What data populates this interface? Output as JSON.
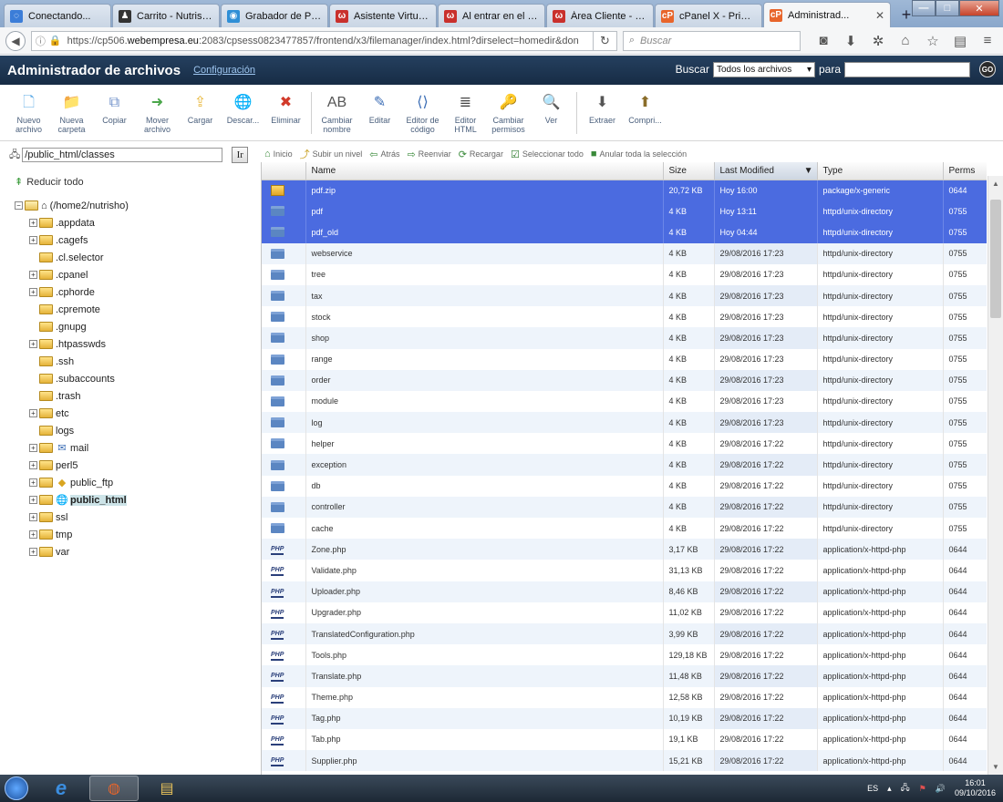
{
  "browser": {
    "tabs": [
      {
        "label": "Conectando...",
        "icon": "loading-icon",
        "color": "#3b7dd8",
        "glyph": "◌"
      },
      {
        "label": "Carrito - Nutrish...",
        "icon": "cart-icon",
        "color": "#333333",
        "glyph": "♟"
      },
      {
        "label": "Grabador de Pa...",
        "icon": "recorder-icon",
        "color": "#2f8fd6",
        "glyph": "◉"
      },
      {
        "label": "Asistente Virtual...",
        "icon": "w-icon",
        "color": "#c9302c",
        "glyph": "ω"
      },
      {
        "label": "Al entrar en el b...",
        "icon": "w-icon",
        "color": "#c9302c",
        "glyph": "ω"
      },
      {
        "label": "Área Cliente - W...",
        "icon": "w-icon",
        "color": "#c9302c",
        "glyph": "ω"
      },
      {
        "label": "cPanel X - Princi...",
        "icon": "cpanel-icon",
        "color": "#e8652b",
        "glyph": "cP"
      },
      {
        "label": "Administrad...",
        "icon": "cpanel-icon",
        "color": "#e8652b",
        "glyph": "cP"
      }
    ],
    "url_prefix": "https://cp506.",
    "url_domain": "webempresa.eu",
    "url_rest": ":2083/cpsess0823477857/frontend/x3/filemanager/index.html?dirselect=homedir&don",
    "search_placeholder": "Buscar"
  },
  "header": {
    "title": "Administrador de archivos",
    "config_link": "Configuración",
    "search_label": "Buscar",
    "search_scope": "Todos los archivos",
    "for_label": "para",
    "go_label": "GO"
  },
  "toolbar": [
    {
      "label": "Nuevo archivo",
      "icon": "new-file-icon",
      "glyph": "🗋",
      "color": "#5aa9e6"
    },
    {
      "label": "Nueva carpeta",
      "icon": "new-folder-icon",
      "glyph": "📁",
      "color": "#e8b83c"
    },
    {
      "label": "Copiar",
      "icon": "copy-icon",
      "glyph": "⧉",
      "color": "#6a8cc7"
    },
    {
      "label": "Mover archivo",
      "icon": "move-file-icon",
      "glyph": "➜",
      "color": "#4aa64a"
    },
    {
      "label": "Cargar",
      "icon": "upload-icon",
      "glyph": "⇪",
      "color": "#e8b83c"
    },
    {
      "label": "Descar...",
      "icon": "download-icon",
      "glyph": "🌐",
      "color": "#3b7dd8"
    },
    {
      "label": "Eliminar",
      "icon": "delete-icon",
      "glyph": "✖",
      "color": "#d23a2a"
    },
    {
      "label": "Cambiar nombre",
      "icon": "rename-icon",
      "glyph": "AB",
      "color": "#555555"
    },
    {
      "label": "Editar",
      "icon": "edit-icon",
      "glyph": "✎",
      "color": "#3b6db5"
    },
    {
      "label": "Editor de código",
      "icon": "code-editor-icon",
      "glyph": "⟨⟩",
      "color": "#3b6db5"
    },
    {
      "label": "Editor HTML",
      "icon": "html-editor-icon",
      "glyph": "≣",
      "color": "#444444"
    },
    {
      "label": "Cambiar permisos",
      "icon": "permissions-icon",
      "glyph": "🔑",
      "color": "#d9a520"
    },
    {
      "label": "Ver",
      "icon": "view-icon",
      "glyph": "🔍",
      "color": "#3b7dd8"
    },
    {
      "label": "Extraer",
      "icon": "extract-icon",
      "glyph": "⬇",
      "color": "#555555"
    },
    {
      "label": "Compri...",
      "icon": "compress-icon",
      "glyph": "⬆",
      "color": "#8a6d2a"
    }
  ],
  "path": {
    "value": "/public_html/classes",
    "go_label": "Ir"
  },
  "subtoolbar": [
    {
      "label": "Inicio",
      "icon": "home-icon",
      "glyph": "⌂"
    },
    {
      "label": "Subir un nivel",
      "icon": "up-level-icon",
      "glyph": "⤴"
    },
    {
      "label": "Atrás",
      "icon": "back-icon",
      "glyph": "⇦"
    },
    {
      "label": "Reenviar",
      "icon": "forward-icon",
      "glyph": "⇨"
    },
    {
      "label": "Recargar",
      "icon": "reload-icon",
      "glyph": "⟳"
    },
    {
      "label": "Seleccionar todo",
      "icon": "select-all-icon",
      "glyph": "☑"
    },
    {
      "label": "Anular toda la selección",
      "icon": "unselect-all-icon",
      "glyph": "■"
    }
  ],
  "tree": {
    "collapse_label": "Reducir todo",
    "root": "(/home2/nutrisho)",
    "items": [
      {
        "label": ".appdata",
        "exp": true
      },
      {
        "label": ".cagefs",
        "exp": true
      },
      {
        "label": ".cl.selector",
        "exp": false
      },
      {
        "label": ".cpanel",
        "exp": true
      },
      {
        "label": ".cphorde",
        "exp": true
      },
      {
        "label": ".cpremote",
        "exp": false
      },
      {
        "label": ".gnupg",
        "exp": false
      },
      {
        "label": ".htpasswds",
        "exp": true
      },
      {
        "label": ".ssh",
        "exp": false
      },
      {
        "label": ".subaccounts",
        "exp": false
      },
      {
        "label": ".trash",
        "exp": false
      },
      {
        "label": "etc",
        "exp": true
      },
      {
        "label": "logs",
        "exp": false
      },
      {
        "label": "mail",
        "exp": true,
        "special": "mail-icon"
      },
      {
        "label": "perl5",
        "exp": true
      },
      {
        "label": "public_ftp",
        "exp": true,
        "special": "ftp-icon"
      },
      {
        "label": "public_html",
        "exp": true,
        "special": "globe-icon",
        "selected": true
      },
      {
        "label": "ssl",
        "exp": true
      },
      {
        "label": "tmp",
        "exp": true
      },
      {
        "label": "var",
        "exp": true
      }
    ]
  },
  "grid": {
    "columns": [
      "Name",
      "Size",
      "Last Modified",
      "Type",
      "Perms"
    ],
    "rows": [
      {
        "kind": "zip",
        "name": "pdf.zip",
        "size": "20,72 KB",
        "modified": "Hoy 16:00",
        "type": "package/x-generic",
        "perms": "0644",
        "selected": true
      },
      {
        "kind": "dir",
        "name": "pdf",
        "size": "4 KB",
        "modified": "Hoy 13:11",
        "type": "httpd/unix-directory",
        "perms": "0755",
        "selected": true
      },
      {
        "kind": "dir",
        "name": "pdf_old",
        "size": "4 KB",
        "modified": "Hoy 04:44",
        "type": "httpd/unix-directory",
        "perms": "0755",
        "selected": true
      },
      {
        "kind": "dir",
        "name": "webservice",
        "size": "4 KB",
        "modified": "29/08/2016 17:23",
        "type": "httpd/unix-directory",
        "perms": "0755"
      },
      {
        "kind": "dir",
        "name": "tree",
        "size": "4 KB",
        "modified": "29/08/2016 17:23",
        "type": "httpd/unix-directory",
        "perms": "0755"
      },
      {
        "kind": "dir",
        "name": "tax",
        "size": "4 KB",
        "modified": "29/08/2016 17:23",
        "type": "httpd/unix-directory",
        "perms": "0755"
      },
      {
        "kind": "dir",
        "name": "stock",
        "size": "4 KB",
        "modified": "29/08/2016 17:23",
        "type": "httpd/unix-directory",
        "perms": "0755"
      },
      {
        "kind": "dir",
        "name": "shop",
        "size": "4 KB",
        "modified": "29/08/2016 17:23",
        "type": "httpd/unix-directory",
        "perms": "0755"
      },
      {
        "kind": "dir",
        "name": "range",
        "size": "4 KB",
        "modified": "29/08/2016 17:23",
        "type": "httpd/unix-directory",
        "perms": "0755"
      },
      {
        "kind": "dir",
        "name": "order",
        "size": "4 KB",
        "modified": "29/08/2016 17:23",
        "type": "httpd/unix-directory",
        "perms": "0755"
      },
      {
        "kind": "dir",
        "name": "module",
        "size": "4 KB",
        "modified": "29/08/2016 17:23",
        "type": "httpd/unix-directory",
        "perms": "0755"
      },
      {
        "kind": "dir",
        "name": "log",
        "size": "4 KB",
        "modified": "29/08/2016 17:23",
        "type": "httpd/unix-directory",
        "perms": "0755"
      },
      {
        "kind": "dir",
        "name": "helper",
        "size": "4 KB",
        "modified": "29/08/2016 17:22",
        "type": "httpd/unix-directory",
        "perms": "0755"
      },
      {
        "kind": "dir",
        "name": "exception",
        "size": "4 KB",
        "modified": "29/08/2016 17:22",
        "type": "httpd/unix-directory",
        "perms": "0755"
      },
      {
        "kind": "dir",
        "name": "db",
        "size": "4 KB",
        "modified": "29/08/2016 17:22",
        "type": "httpd/unix-directory",
        "perms": "0755"
      },
      {
        "kind": "dir",
        "name": "controller",
        "size": "4 KB",
        "modified": "29/08/2016 17:22",
        "type": "httpd/unix-directory",
        "perms": "0755"
      },
      {
        "kind": "dir",
        "name": "cache",
        "size": "4 KB",
        "modified": "29/08/2016 17:22",
        "type": "httpd/unix-directory",
        "perms": "0755"
      },
      {
        "kind": "php",
        "name": "Zone.php",
        "size": "3,17 KB",
        "modified": "29/08/2016 17:22",
        "type": "application/x-httpd-php",
        "perms": "0644"
      },
      {
        "kind": "php",
        "name": "Validate.php",
        "size": "31,13 KB",
        "modified": "29/08/2016 17:22",
        "type": "application/x-httpd-php",
        "perms": "0644"
      },
      {
        "kind": "php",
        "name": "Uploader.php",
        "size": "8,46 KB",
        "modified": "29/08/2016 17:22",
        "type": "application/x-httpd-php",
        "perms": "0644"
      },
      {
        "kind": "php",
        "name": "Upgrader.php",
        "size": "11,02 KB",
        "modified": "29/08/2016 17:22",
        "type": "application/x-httpd-php",
        "perms": "0644"
      },
      {
        "kind": "php",
        "name": "TranslatedConfiguration.php",
        "size": "3,99 KB",
        "modified": "29/08/2016 17:22",
        "type": "application/x-httpd-php",
        "perms": "0644"
      },
      {
        "kind": "php",
        "name": "Tools.php",
        "size": "129,18 KB",
        "modified": "29/08/2016 17:22",
        "type": "application/x-httpd-php",
        "perms": "0644"
      },
      {
        "kind": "php",
        "name": "Translate.php",
        "size": "11,48 KB",
        "modified": "29/08/2016 17:22",
        "type": "application/x-httpd-php",
        "perms": "0644"
      },
      {
        "kind": "php",
        "name": "Theme.php",
        "size": "12,58 KB",
        "modified": "29/08/2016 17:22",
        "type": "application/x-httpd-php",
        "perms": "0644"
      },
      {
        "kind": "php",
        "name": "Tag.php",
        "size": "10,19 KB",
        "modified": "29/08/2016 17:22",
        "type": "application/x-httpd-php",
        "perms": "0644"
      },
      {
        "kind": "php",
        "name": "Tab.php",
        "size": "19,1 KB",
        "modified": "29/08/2016 17:22",
        "type": "application/x-httpd-php",
        "perms": "0644"
      },
      {
        "kind": "php",
        "name": "Supplier.php",
        "size": "15,21 KB",
        "modified": "29/08/2016 17:22",
        "type": "application/x-httpd-php",
        "perms": "0644"
      }
    ]
  },
  "taskbar": {
    "apps": [
      {
        "icon": "ie-icon",
        "glyph": "e",
        "color": "#3b8ee0"
      },
      {
        "icon": "firefox-icon",
        "glyph": "◍",
        "color": "#e8652b",
        "active": true
      },
      {
        "icon": "explorer-icon",
        "glyph": "▤",
        "color": "#e8c25a"
      }
    ],
    "lang": "ES",
    "time": "16:01",
    "date": "09/10/2016"
  }
}
